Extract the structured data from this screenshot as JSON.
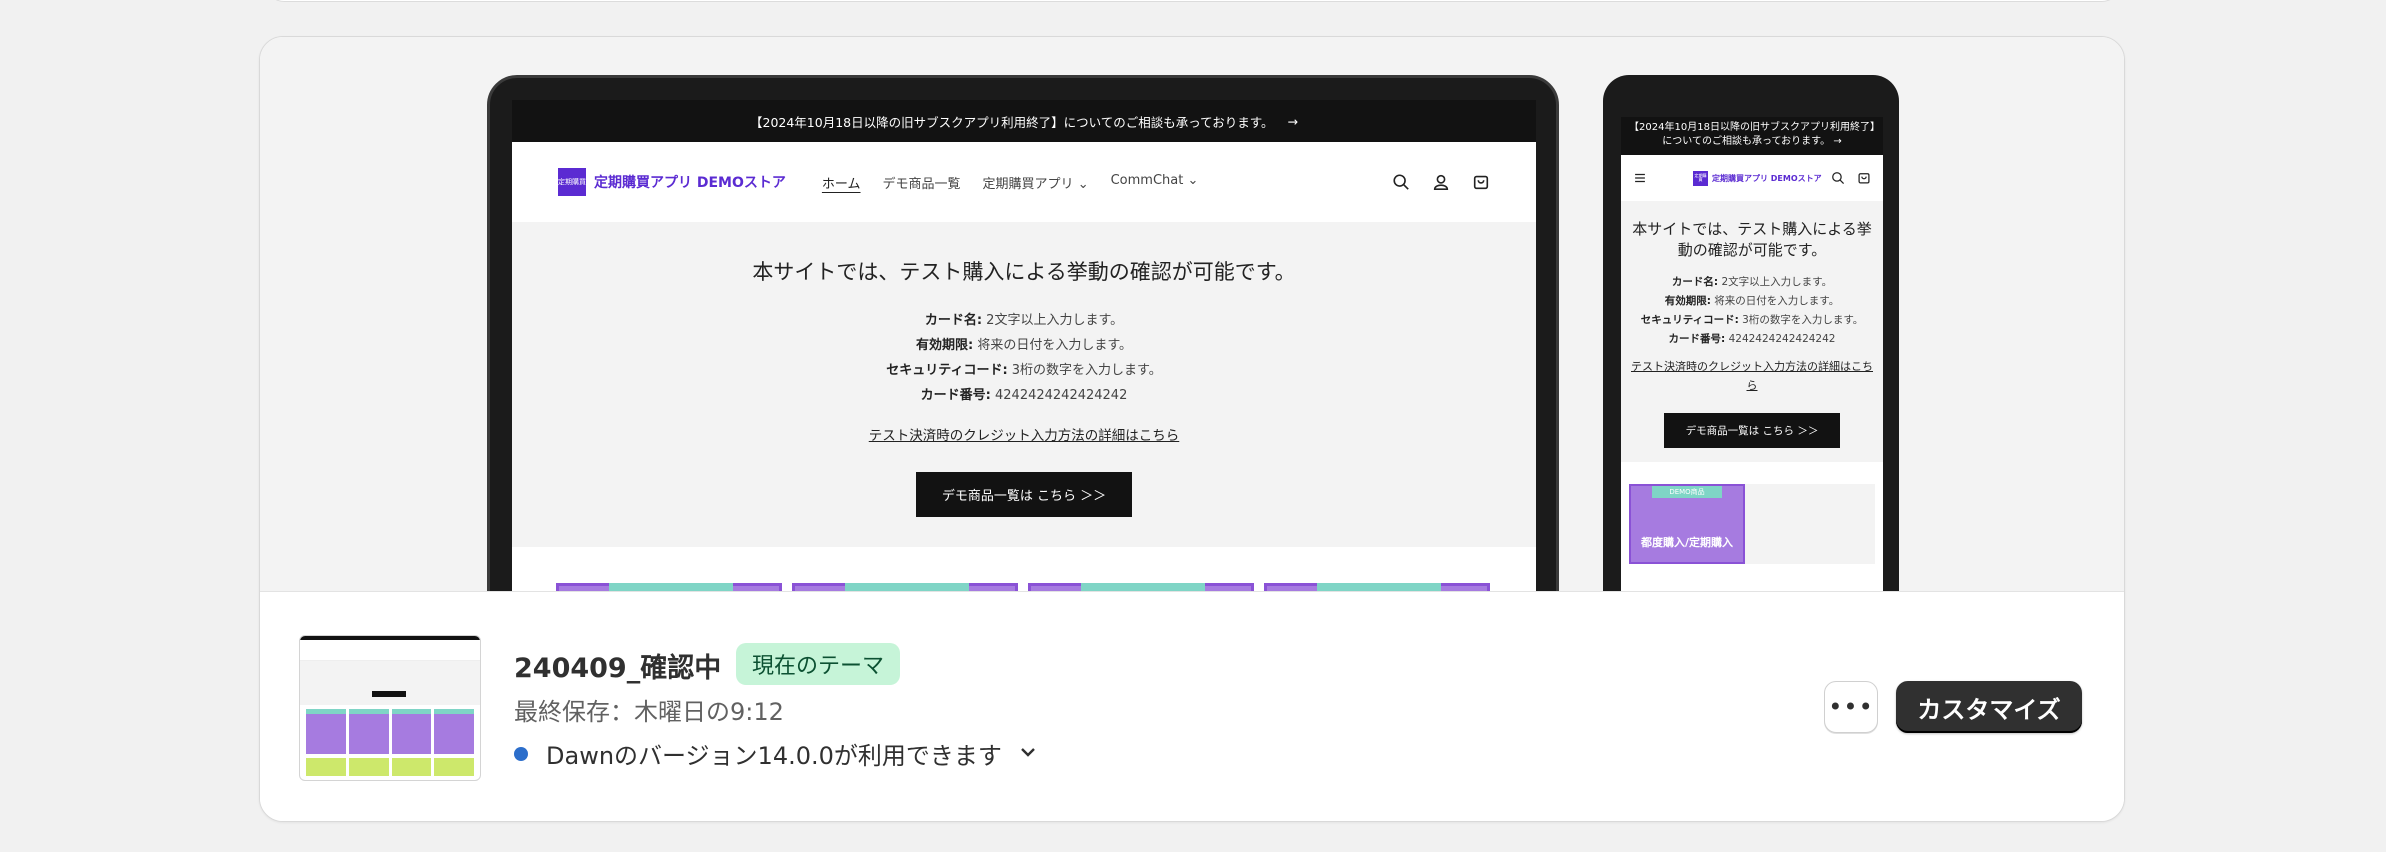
{
  "preview": {
    "announcement": "【2024年10月18日以降の旧サブスクアプリ利用終了】についてのご相談も承っております。",
    "mobile_announcement": "【2024年10月18日以降の旧サブスクアプリ利用終了】についてのご相談も承っております。",
    "logo_mark": "定期購買",
    "store_name": "定期購買アプリ DEMOストア",
    "nav": [
      "ホーム",
      "デモ商品一覧",
      "定期購買アプリ",
      "CommChat"
    ],
    "hero_title": "本サイトでは、テスト購入による挙動の確認が可能です。",
    "mobile_hero_title": "本サイトでは、テスト購入による挙動の確認が可能です。",
    "lines": [
      {
        "label": "カード名:",
        "value": "2文字以上入力します。"
      },
      {
        "label": "有効期限:",
        "value": "将来の日付を入力します。"
      },
      {
        "label": "セキュリティコード:",
        "value": "3桁の数字を入力します。"
      },
      {
        "label": "カード番号:",
        "value": "4242424242424242"
      }
    ],
    "link": "テスト決済時のクレジット入力方法の詳細はこちら",
    "button": "デモ商品一覧は こちら ＞＞",
    "mobile_product_badge": "DEMO商品",
    "mobile_product_title": "都度購入/定期購入"
  },
  "theme": {
    "name": "240409_確認中",
    "status": "現在のテーマ",
    "last_saved": "最終保存：木曜日の9:12",
    "version_notice": "Dawnのバージョン14.0.0が利用できます",
    "more_label": "•••",
    "customize_label": "カスタマイズ"
  },
  "colors": {
    "badge_bg": "#c6f4d8",
    "primary_button": "#303030",
    "notice_dot": "#2c6ecb",
    "brand": "#5b2bd2"
  }
}
